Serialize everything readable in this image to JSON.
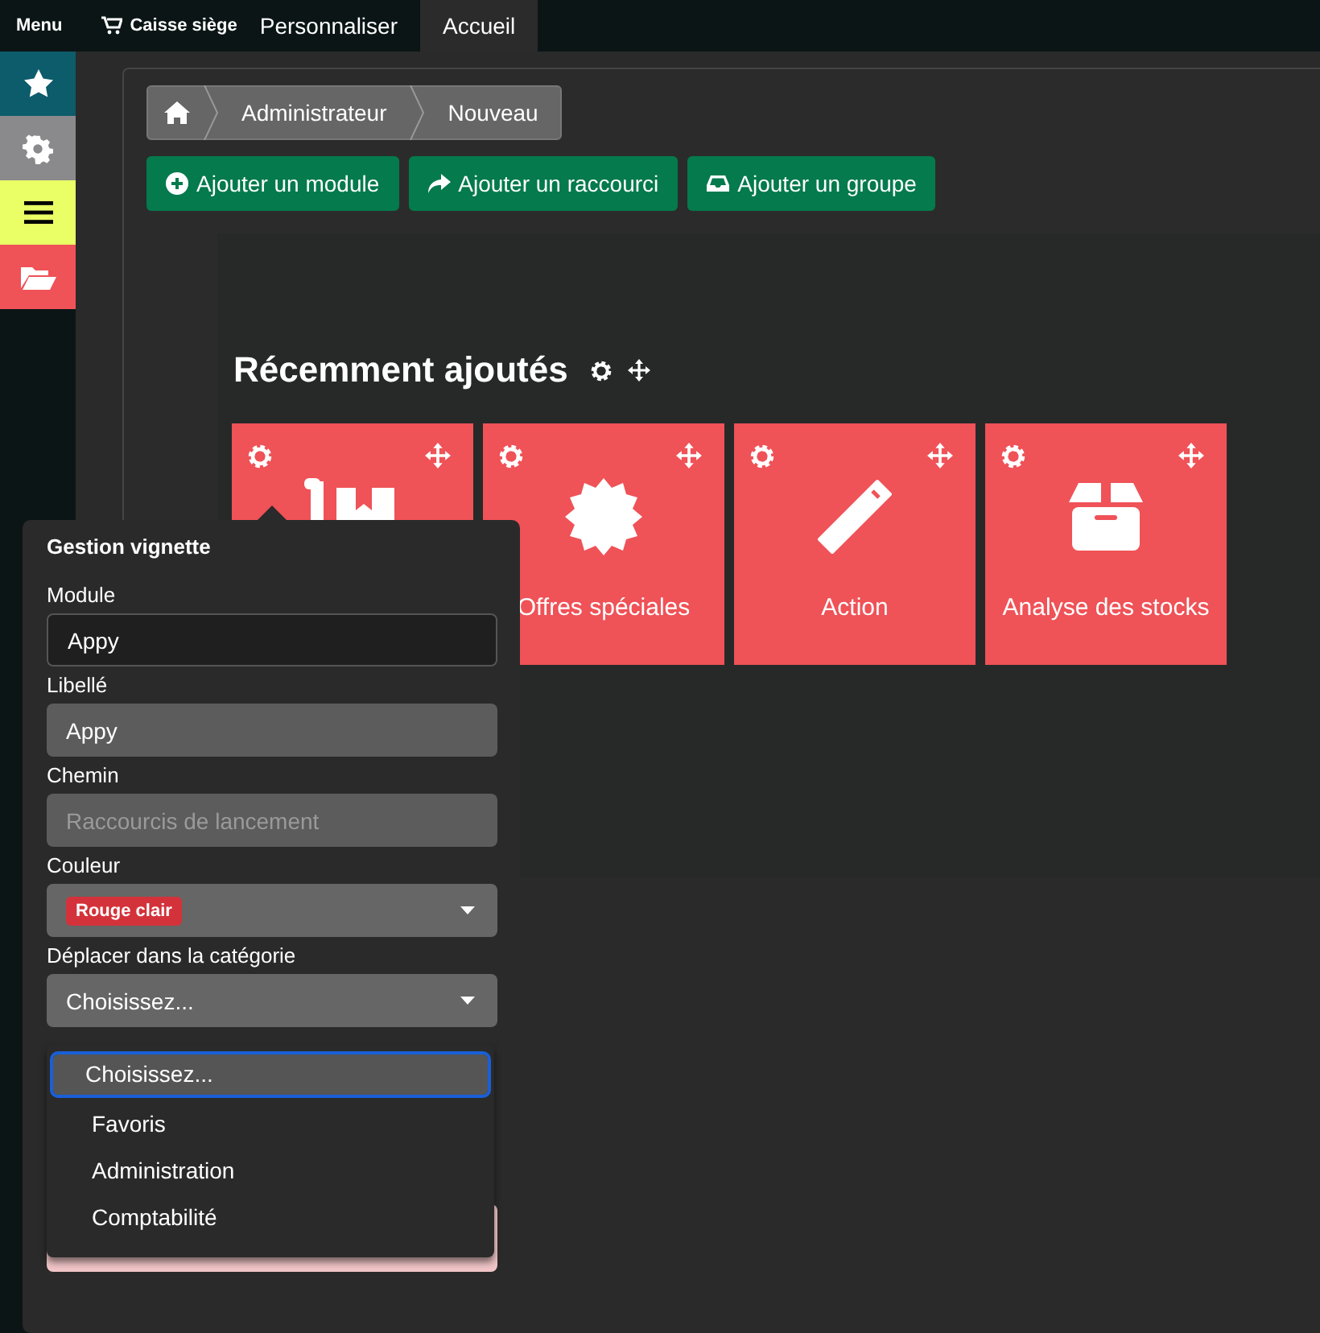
{
  "top_bar": {
    "menu": "Menu",
    "shop": "Caisse siège",
    "tabs": [
      {
        "label": "Personnaliser",
        "selected": false
      },
      {
        "label": "Accueil",
        "selected": true
      }
    ]
  },
  "sidebar": {
    "items": [
      {
        "kind": "star",
        "color": "#0d5c6b"
      },
      {
        "kind": "gear",
        "color": "#8a8a8c"
      },
      {
        "kind": "bars",
        "color": "#eaff66"
      },
      {
        "kind": "folder",
        "color": "#ef5257"
      }
    ]
  },
  "breadcrumb": [
    "Administrateur",
    "Nouveau"
  ],
  "actions": [
    {
      "kind": "plus",
      "label": "Ajouter un module"
    },
    {
      "kind": "share",
      "label": "Ajouter un raccourci"
    },
    {
      "kind": "inbox",
      "label": "Ajouter un groupe"
    }
  ],
  "section": {
    "title": "Récemment ajoutés",
    "tiles": [
      {
        "kind": "dolly"
      },
      {
        "kind": "badge",
        "label": "Offres spéciales"
      },
      {
        "kind": "wand",
        "label": "Action"
      },
      {
        "kind": "box",
        "label": "Analyse des stocks"
      }
    ]
  },
  "popover": {
    "title": "Gestion vignette",
    "fields": [
      {
        "kind": "input",
        "label": "Module",
        "value": "Appy"
      },
      {
        "kind": "readonly",
        "label": "Libellé",
        "value": "Appy"
      },
      {
        "kind": "readonly",
        "label": "Chemin",
        "placeholder": "Raccourcis de lancement"
      },
      {
        "kind": "color-select",
        "label": "Couleur",
        "value": "Rouge clair"
      },
      {
        "kind": "select",
        "label": "Déplacer dans la catégorie",
        "value": "Choisissez..."
      }
    ],
    "dropdown_options": [
      {
        "label": "Choisissez...",
        "selected": true
      },
      {
        "label": "Favoris",
        "selected": false
      },
      {
        "label": "Administration",
        "selected": false
      },
      {
        "label": "Comptabilité",
        "selected": false
      }
    ]
  }
}
